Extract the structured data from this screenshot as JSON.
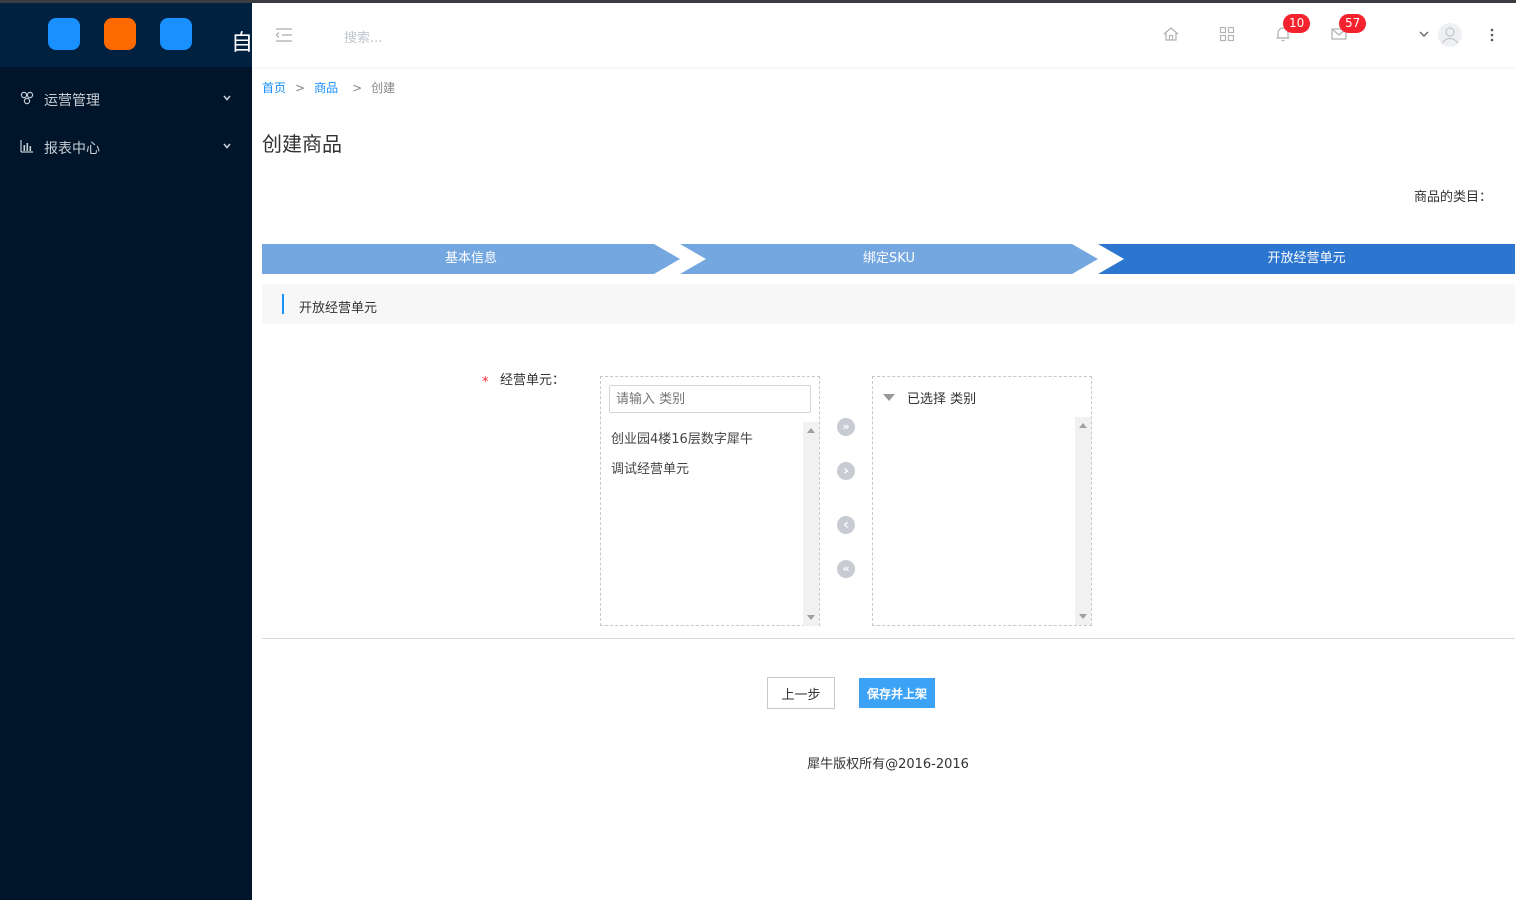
{
  "sidebar": {
    "brand_char": "自",
    "app_colors": [
      "#1890ff",
      "#ff6a00",
      "#1890ff"
    ],
    "items": [
      {
        "label": "运营管理",
        "icon": "cluster-icon"
      },
      {
        "label": "报表中心",
        "icon": "bar-chart-icon"
      }
    ]
  },
  "header": {
    "search_placeholder": "搜索...",
    "notifications_badge": "10",
    "messages_badge": "57",
    "icons": [
      "menu-fold-icon",
      "home-icon",
      "apps-icon",
      "bell-icon",
      "mail-icon",
      "chevron-down-icon",
      "user-avatar-icon",
      "more-icon"
    ]
  },
  "breadcrumb": {
    "home": "首页",
    "products": "商品",
    "current": "创建",
    "separator": ">"
  },
  "page": {
    "title": "创建商品",
    "category_label": "商品的类目："
  },
  "steps": [
    {
      "label": "基本信息",
      "active": false
    },
    {
      "label": "绑定SKU",
      "active": false
    },
    {
      "label": "开放经营单元",
      "active": true
    }
  ],
  "colors": {
    "step_inactive": "#74a6e0",
    "step_active": "#2c76cf",
    "sidebar_bg": "#001529",
    "primary": "#3ca2f5"
  },
  "section": {
    "title": "开放经营单元"
  },
  "form": {
    "required_mark": "*",
    "field_label": "经营单元：",
    "filter_placeholder": "请输入 类别",
    "available_items": [
      "创业园4楼16层数字犀牛",
      "调试经营单元"
    ],
    "selected_header": "已选择 类别",
    "transfer_buttons": {
      "move_all_right": "»",
      "move_right": "›",
      "move_left": "‹",
      "move_all_left": "«"
    }
  },
  "actions": {
    "prev_label": "上一步",
    "save_label": "保存并上架"
  },
  "footer": {
    "copyright": "犀牛版权所有@2016-2016"
  }
}
